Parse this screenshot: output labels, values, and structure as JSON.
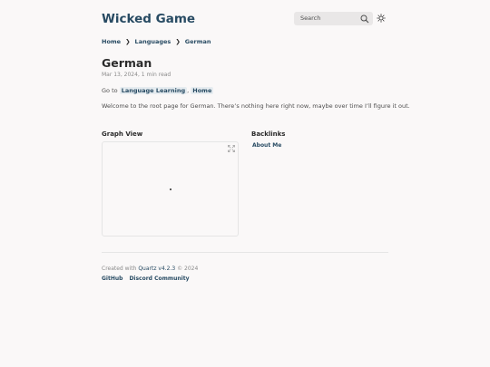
{
  "header": {
    "site_title": "Wicked Game",
    "search_placeholder": "Search",
    "icons": [
      "search-icon",
      "sun-icon"
    ]
  },
  "breadcrumb": {
    "items": [
      "Home",
      "Languages",
      "German"
    ],
    "separator": "❯"
  },
  "article": {
    "title": "German",
    "date": "Mar 13, 2024",
    "reading_time": "1 min read",
    "goto_prefix": "Go to",
    "goto_links": [
      "Language Learning",
      "Home"
    ],
    "goto_separator": ",",
    "body": "Welcome to the root page for German. There’s nothing here right now, maybe over time I’ll figure it out."
  },
  "graph": {
    "heading": "Graph View",
    "icons": [
      "expand-icon"
    ]
  },
  "backlinks": {
    "heading": "Backlinks",
    "items": [
      "About Me"
    ]
  },
  "footer": {
    "created_prefix": "Created with",
    "quartz_link": "Quartz v4.2.3",
    "copyright": "© 2024",
    "links": [
      "GitHub",
      "Discord Community"
    ]
  },
  "colors": {
    "background": "#faf8f8",
    "accent": "#284b63",
    "text": "#4e4e4e",
    "heading": "#2b2b2b",
    "muted": "#8a8a8a"
  }
}
